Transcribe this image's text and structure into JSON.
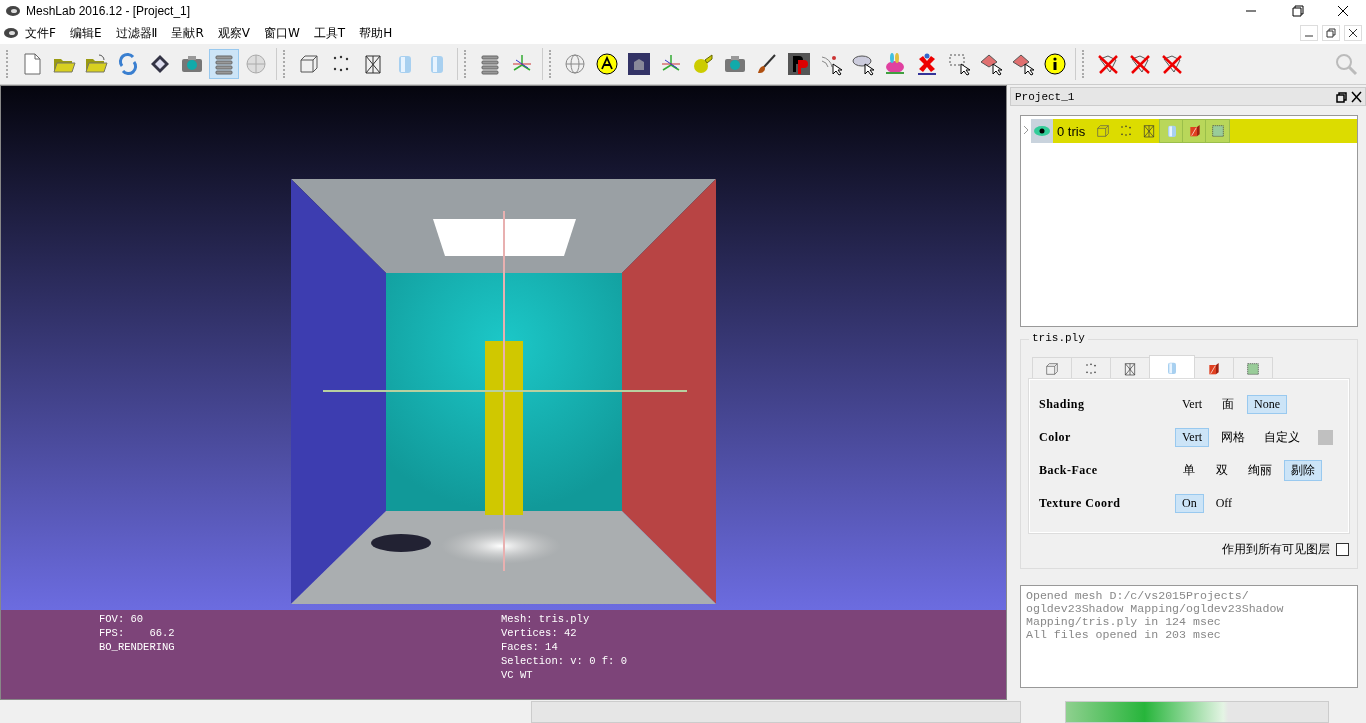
{
  "window": {
    "title": "MeshLab 2016.12 - [Project_1]"
  },
  "menu": [
    "文件F",
    "编辑E",
    "过滤器Ⅱ",
    "呈献R",
    "观察V",
    "窗口W",
    "工具T",
    "帮助H"
  ],
  "toolbar": [
    {
      "kind": "new-file",
      "selected": false
    },
    {
      "kind": "open-folder",
      "selected": false
    },
    {
      "kind": "open-project",
      "selected": false
    },
    {
      "kind": "reload",
      "selected": false
    },
    {
      "kind": "save",
      "selected": false
    },
    {
      "kind": "snapshot",
      "selected": false
    },
    {
      "kind": "layers",
      "selected": true
    },
    {
      "kind": "sphere",
      "selected": false
    },
    {
      "kind": "sep"
    },
    {
      "kind": "box",
      "selected": false
    },
    {
      "kind": "points",
      "selected": false
    },
    {
      "kind": "wireframe",
      "selected": false
    },
    {
      "kind": "cylinder",
      "selected": false
    },
    {
      "kind": "cylinder",
      "selected": false
    },
    {
      "kind": "sep"
    },
    {
      "kind": "layers",
      "selected": false
    },
    {
      "kind": "axes",
      "selected": false
    },
    {
      "kind": "sep"
    },
    {
      "kind": "globe",
      "selected": false
    },
    {
      "kind": "annotation",
      "selected": false
    },
    {
      "kind": "museum",
      "selected": false
    },
    {
      "kind": "axes",
      "selected": false
    },
    {
      "kind": "measure",
      "selected": false
    },
    {
      "kind": "snapshot",
      "selected": false
    },
    {
      "kind": "brush",
      "selected": false
    },
    {
      "kind": "plugin",
      "selected": false
    },
    {
      "kind": "select-points",
      "selected": false
    },
    {
      "kind": "select-ellipse",
      "selected": false
    },
    {
      "kind": "bunny",
      "selected": false
    },
    {
      "kind": "georef",
      "selected": false
    },
    {
      "kind": "select-rect",
      "selected": false
    },
    {
      "kind": "select-faces",
      "selected": false
    },
    {
      "kind": "select-faces",
      "selected": false
    },
    {
      "kind": "info",
      "selected": false
    },
    {
      "kind": "sep"
    },
    {
      "kind": "delete",
      "selected": false
    },
    {
      "kind": "delete",
      "selected": false
    },
    {
      "kind": "delete",
      "selected": false
    }
  ],
  "viewport": {
    "info_left": [
      "FOV: 60",
      "FPS:    66.2",
      "BO_RENDERING"
    ],
    "info_right": [
      "Mesh: tris.ply",
      "Vertices: 42",
      "Faces: 14",
      "Selection: v: 0 f: 0",
      "VC WT"
    ]
  },
  "layers_panel": {
    "title": "Project_1",
    "layers": [
      {
        "label": "0 tris",
        "visible": true,
        "selected": true,
        "modes": [
          {
            "kind": "box",
            "on": false
          },
          {
            "kind": "points",
            "on": false
          },
          {
            "kind": "wireframe",
            "on": false
          },
          {
            "kind": "cylinder",
            "on": true
          },
          {
            "kind": "texture",
            "on": true
          },
          {
            "kind": "bbox",
            "on": true
          }
        ]
      }
    ]
  },
  "render_panel": {
    "title": "tris.ply",
    "tabs": [
      {
        "kind": "box",
        "selected": false
      },
      {
        "kind": "points",
        "selected": false
      },
      {
        "kind": "wireframe",
        "selected": false
      },
      {
        "kind": "cylinder",
        "selected": true
      },
      {
        "kind": "texture",
        "selected": false
      },
      {
        "kind": "bbox",
        "selected": false
      }
    ],
    "rows": [
      {
        "kind": "options",
        "label": "Shading",
        "options": [
          {
            "label": "Vert",
            "selected": false
          },
          {
            "label": "面",
            "selected": false
          },
          {
            "label": "None",
            "selected": true
          }
        ]
      },
      {
        "kind": "color",
        "label": "Color",
        "options": [
          {
            "label": "Vert",
            "selected": true
          },
          {
            "label": "网格",
            "selected": false
          },
          {
            "label": "自定义",
            "selected": false
          }
        ]
      },
      {
        "kind": "options",
        "label": "Back-Face",
        "options": [
          {
            "label": "单",
            "selected": false
          },
          {
            "label": "双",
            "selected": false
          },
          {
            "label": "绚丽",
            "selected": false
          },
          {
            "label": "剔除",
            "selected": true
          }
        ]
      },
      {
        "kind": "options",
        "label": "Texture Coord",
        "options": [
          {
            "label": "On",
            "selected": true
          },
          {
            "label": "Off",
            "selected": false
          }
        ]
      }
    ],
    "apply_all": {
      "label": "作用到所有可见图层",
      "checked": false
    }
  },
  "log": [
    "Opened mesh D:/c/vs2015Projects/",
    "ogldev23Shadow Mapping/ogldev23Shadow",
    "Mapping/tris.ply in 124 msec",
    "All files opened in 203 msec"
  ]
}
